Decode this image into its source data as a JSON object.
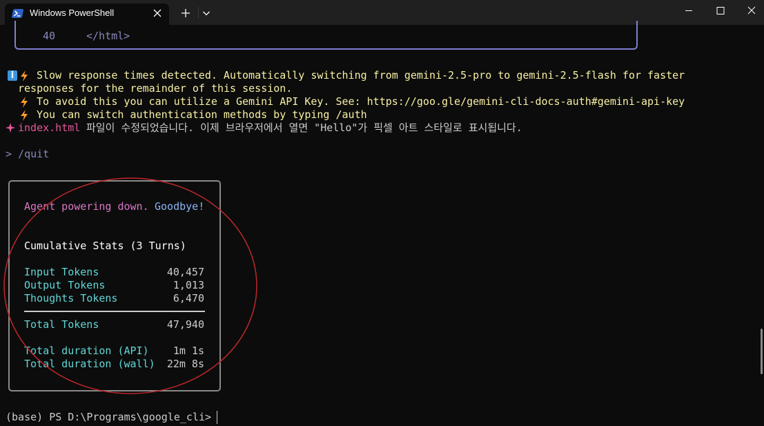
{
  "tab": {
    "title": "Windows PowerShell"
  },
  "terminal": {
    "prev_line_number": "40",
    "prev_line_code": "</html>",
    "warning_line1": "Slow response times detected. Automatically switching from gemini-2.5-pro to gemini-2.5-flash for faster",
    "warning_line2": "responses for the remainder of this session.",
    "warning_line3": "To avoid this you can utilize a Gemini API Key. See: https://goo.gle/gemini-cli-docs-auth#gemini-api-key",
    "warning_line4": "You can switch authentication methods by typing /auth",
    "file_name": "index.html",
    "file_message": "파일이 수정되었습니다. 이제 브라우저에서 열면 \"Hello\"가 픽셀 아트 스타일로 표시됩니다.",
    "quit_command": "> /quit",
    "prompt": "(base) PS D:\\Programs\\google_cli> "
  },
  "stats": {
    "farewell_agent": "Agent powering down.",
    "farewell_goodbye": "Goodbye!",
    "heading": "Cumulative Stats (3 Turns)",
    "rows": [
      {
        "label": "Input Tokens",
        "value": "40,457"
      },
      {
        "label": "Output Tokens",
        "value": "1,013"
      },
      {
        "label": "Thoughts Tokens",
        "value": "6,470"
      }
    ],
    "total_label": "Total Tokens",
    "total_value": "47,940",
    "durations": [
      {
        "label": "Total duration (API)",
        "value": "1m 1s"
      },
      {
        "label": "Total duration (wall)",
        "value": "22m 8s"
      }
    ]
  },
  "colors": {
    "warning_text": "#f9f1a5",
    "lightning": "#ff9e2c",
    "file_name": "#e4569a",
    "stat_label": "#61d6d6",
    "annotation_circle": "#c0282b"
  },
  "icons": {
    "tab_icon": "powershell-icon",
    "tab_close": "close-icon",
    "new_tab": "plus-icon",
    "dropdown": "chevron-down-icon",
    "minimize": "minimize-icon",
    "maximize": "maximize-icon",
    "window_close": "close-icon",
    "info": "info-icon",
    "lightning": "lightning-icon",
    "sparkle": "sparkle-icon"
  }
}
